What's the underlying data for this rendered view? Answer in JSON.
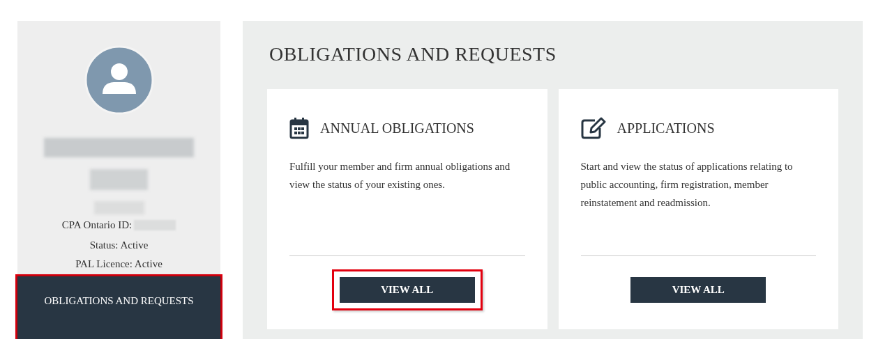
{
  "sidebar": {
    "id_label": "CPA Ontario ID:",
    "status": "Status: Active",
    "licence": "PAL Licence: Active",
    "nav_button": {
      "label": "OBLIGATIONS AND REQUESTS",
      "highlighted": true
    }
  },
  "main": {
    "title": "OBLIGATIONS AND REQUESTS",
    "cards": [
      {
        "kind": "calendar",
        "heading": "ANNUAL OBLIGATIONS",
        "description": "Fulfill your member and firm annual obligations and view the status of your existing ones.",
        "button": {
          "label": "VIEW ALL",
          "highlighted": true
        }
      },
      {
        "kind": "edit",
        "heading": "APPLICATIONS",
        "description": "Start and view the status of applications relating to public accounting, firm registration, member reinstatement and readmission.",
        "button": {
          "label": "VIEW ALL",
          "highlighted": false
        }
      }
    ]
  }
}
